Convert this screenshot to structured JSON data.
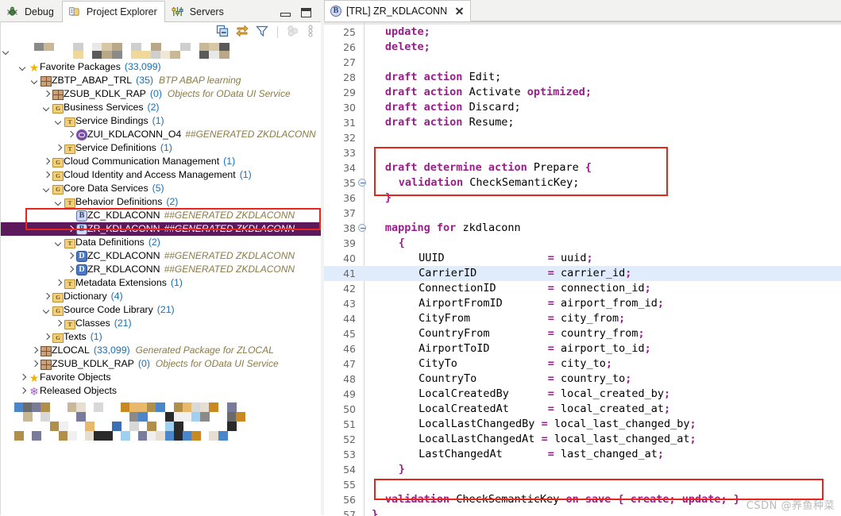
{
  "view_tabs": [
    {
      "label": "Debug",
      "icon": "bug-icon",
      "active": false
    },
    {
      "label": "Project Explorer",
      "icon": "project-explorer-icon",
      "active": true
    },
    {
      "label": "Servers",
      "icon": "servers-icon",
      "active": false
    }
  ],
  "window_controls": {
    "minimize": "minimize-icon",
    "maximize": "maximize-icon"
  },
  "view_toolbar": [
    {
      "name": "collapse-all-icon",
      "label": "Collapse All"
    },
    {
      "name": "link-with-editor-icon",
      "label": "Link with Editor"
    },
    {
      "name": "filter-icon",
      "label": "Filters"
    },
    {
      "name": "group-icon",
      "label": "Grouping"
    },
    {
      "name": "view-menu-icon",
      "label": "View Menu"
    }
  ],
  "tree": {
    "blurred_top_row": true,
    "blurred_bottom_block": true,
    "nodes": [
      {
        "indent": 1,
        "arrow": "down",
        "icon": "star-icon",
        "name": "Favorite Packages",
        "count": "(33,099)",
        "desc": "",
        "selected": false
      },
      {
        "indent": 2,
        "arrow": "down",
        "icon": "package-icon",
        "name": "ZBTP_ABAP_TRL",
        "count": "(35)",
        "desc": "BTP ABAP learning",
        "selected": false
      },
      {
        "indent": 3,
        "arrow": "right",
        "icon": "package-icon",
        "name": "ZSUB_KDLK_RAP",
        "count": "(0)",
        "desc": "Objects for OData UI Service",
        "selected": false
      },
      {
        "indent": 3,
        "arrow": "down",
        "icon": "group-folder-icon",
        "name": "Business Services",
        "count": "(2)",
        "desc": "",
        "selected": false
      },
      {
        "indent": 4,
        "arrow": "down",
        "icon": "type-folder-icon",
        "name": "Service Bindings",
        "count": "(1)",
        "desc": "",
        "selected": false
      },
      {
        "indent": 5,
        "arrow": "right",
        "icon": "service-binding-icon",
        "name": "ZUI_KDLACONN_O4",
        "count": "",
        "desc": "##GENERATED ZKDLACONN",
        "selected": false
      },
      {
        "indent": 4,
        "arrow": "right",
        "icon": "type-folder-icon",
        "name": "Service Definitions",
        "count": "(1)",
        "desc": "",
        "selected": false
      },
      {
        "indent": 3,
        "arrow": "right",
        "icon": "group-folder-icon",
        "name": "Cloud Communication Management",
        "count": "(1)",
        "desc": "",
        "selected": false
      },
      {
        "indent": 3,
        "arrow": "right",
        "icon": "group-folder-icon",
        "name": "Cloud Identity and Access Management",
        "count": "(1)",
        "desc": "",
        "selected": false
      },
      {
        "indent": 3,
        "arrow": "down",
        "icon": "group-folder-icon",
        "name": "Core Data Services",
        "count": "(5)",
        "desc": "",
        "selected": false
      },
      {
        "indent": 4,
        "arrow": "down",
        "icon": "type-folder-icon",
        "name": "Behavior Definitions",
        "count": "(2)",
        "desc": "",
        "selected": false
      },
      {
        "indent": 5,
        "arrow": "none",
        "icon": "behavior-definition-icon",
        "name": "ZC_KDLACONN",
        "count": "",
        "desc": "##GENERATED ZKDLACONN",
        "selected": false
      },
      {
        "indent": 5,
        "arrow": "right",
        "icon": "behavior-definition-icon",
        "name": "ZR_KDLACONN",
        "count": "",
        "desc": "##GENERATED ZKDLACONN",
        "selected": true
      },
      {
        "indent": 4,
        "arrow": "down",
        "icon": "type-folder-icon",
        "name": "Data Definitions",
        "count": "(2)",
        "desc": "",
        "selected": false
      },
      {
        "indent": 5,
        "arrow": "right",
        "icon": "data-definition-icon",
        "name": "ZC_KDLACONN",
        "count": "",
        "desc": "##GENERATED ZKDLACONN",
        "selected": false
      },
      {
        "indent": 5,
        "arrow": "right",
        "icon": "data-definition-icon",
        "name": "ZR_KDLACONN",
        "count": "",
        "desc": "##GENERATED ZKDLACONN",
        "selected": false
      },
      {
        "indent": 4,
        "arrow": "right",
        "icon": "type-folder-icon",
        "name": "Metadata Extensions",
        "count": "(1)",
        "desc": "",
        "selected": false
      },
      {
        "indent": 3,
        "arrow": "right",
        "icon": "group-folder-icon",
        "name": "Dictionary",
        "count": "(4)",
        "desc": "",
        "selected": false
      },
      {
        "indent": 3,
        "arrow": "down",
        "icon": "group-folder-icon",
        "name": "Source Code Library",
        "count": "(21)",
        "desc": "",
        "selected": false
      },
      {
        "indent": 4,
        "arrow": "right",
        "icon": "type-folder-icon",
        "name": "Classes",
        "count": "(21)",
        "desc": "",
        "selected": false
      },
      {
        "indent": 3,
        "arrow": "right",
        "icon": "group-folder-icon",
        "name": "Texts",
        "count": "(1)",
        "desc": "",
        "selected": false
      },
      {
        "indent": 2,
        "arrow": "right",
        "icon": "package-icon",
        "name": "ZLOCAL",
        "count": "(33,099)",
        "desc": "Generated Package for ZLOCAL",
        "selected": false
      },
      {
        "indent": 2,
        "arrow": "right",
        "icon": "package-icon",
        "name": "ZSUB_KDLK_RAP",
        "count": "(0)",
        "desc": "Objects for OData UI Service",
        "selected": false
      },
      {
        "indent": 1,
        "arrow": "right",
        "icon": "star-icon",
        "name": "Favorite Objects",
        "count": "",
        "desc": "",
        "selected": false
      },
      {
        "indent": 1,
        "arrow": "right",
        "icon": "released-objects-icon",
        "name": "Released Objects",
        "count": "",
        "desc": "",
        "selected": false
      }
    ]
  },
  "editor": {
    "tab": {
      "icon": "behavior-definition-icon",
      "label": "[TRL] ZR_KDLACONN",
      "close": "close-icon"
    },
    "lines": [
      {
        "n": 25,
        "fold": false,
        "indent": 2,
        "tokens": [
          {
            "t": "update;",
            "k": true
          }
        ]
      },
      {
        "n": 26,
        "fold": false,
        "indent": 2,
        "tokens": [
          {
            "t": "delete;",
            "k": true
          }
        ]
      },
      {
        "n": 27,
        "fold": false,
        "indent": 0,
        "tokens": []
      },
      {
        "n": 28,
        "fold": false,
        "indent": 2,
        "tokens": [
          {
            "t": "draft action ",
            "k": true
          },
          {
            "t": "Edit;",
            "k": false
          }
        ]
      },
      {
        "n": 29,
        "fold": false,
        "indent": 2,
        "tokens": [
          {
            "t": "draft action ",
            "k": true
          },
          {
            "t": "Activate ",
            "k": false
          },
          {
            "t": "optimized;",
            "k": true
          }
        ]
      },
      {
        "n": 30,
        "fold": false,
        "indent": 2,
        "tokens": [
          {
            "t": "draft action ",
            "k": true
          },
          {
            "t": "Discard;",
            "k": false
          }
        ]
      },
      {
        "n": 31,
        "fold": false,
        "indent": 2,
        "tokens": [
          {
            "t": "draft action ",
            "k": true
          },
          {
            "t": "Resume;",
            "k": false
          }
        ]
      },
      {
        "n": 32,
        "fold": false,
        "indent": 0,
        "tokens": []
      },
      {
        "n": 33,
        "fold": false,
        "indent": 0,
        "tokens": []
      },
      {
        "n": 34,
        "fold": false,
        "indent": 2,
        "tokens": [
          {
            "t": "draft determine action ",
            "k": true
          },
          {
            "t": "Prepare ",
            "k": false
          },
          {
            "t": "{",
            "k": true
          }
        ]
      },
      {
        "n": 35,
        "fold": true,
        "indent": 4,
        "tokens": [
          {
            "t": "validation ",
            "k": true
          },
          {
            "t": "CheckSemanticKey;",
            "k": false
          }
        ]
      },
      {
        "n": 36,
        "fold": false,
        "indent": 2,
        "tokens": [
          {
            "t": "}",
            "k": true
          }
        ]
      },
      {
        "n": 37,
        "fold": false,
        "indent": 0,
        "tokens": []
      },
      {
        "n": 38,
        "fold": true,
        "indent": 2,
        "tokens": [
          {
            "t": "mapping for ",
            "k": true
          },
          {
            "t": "zkdlaconn",
            "k": false
          }
        ]
      },
      {
        "n": 39,
        "fold": false,
        "indent": 4,
        "tokens": [
          {
            "t": "{",
            "k": true
          }
        ]
      },
      {
        "n": 40,
        "fold": false,
        "indent": 7,
        "tokens": [
          {
            "t": "UUID                ",
            "k": false
          },
          {
            "t": "= ",
            "k": true
          },
          {
            "t": "uuid",
            "k": false
          },
          {
            "t": ";",
            "k": true
          }
        ]
      },
      {
        "n": 41,
        "fold": false,
        "indent": 7,
        "highlight": true,
        "tokens": [
          {
            "t": "CarrierID           ",
            "k": false
          },
          {
            "t": "= ",
            "k": true
          },
          {
            "t": "carrier_id",
            "k": false
          },
          {
            "t": ";",
            "k": true
          }
        ]
      },
      {
        "n": 42,
        "fold": false,
        "indent": 7,
        "tokens": [
          {
            "t": "ConnectionID        ",
            "k": false
          },
          {
            "t": "= ",
            "k": true
          },
          {
            "t": "connection_id",
            "k": false
          },
          {
            "t": ";",
            "k": true
          }
        ]
      },
      {
        "n": 43,
        "fold": false,
        "indent": 7,
        "tokens": [
          {
            "t": "AirportFromID       ",
            "k": false
          },
          {
            "t": "= ",
            "k": true
          },
          {
            "t": "airport_from_id",
            "k": false
          },
          {
            "t": ";",
            "k": true
          }
        ]
      },
      {
        "n": 44,
        "fold": false,
        "indent": 7,
        "tokens": [
          {
            "t": "CityFrom            ",
            "k": false
          },
          {
            "t": "= ",
            "k": true
          },
          {
            "t": "city_from",
            "k": false
          },
          {
            "t": ";",
            "k": true
          }
        ]
      },
      {
        "n": 45,
        "fold": false,
        "indent": 7,
        "tokens": [
          {
            "t": "CountryFrom         ",
            "k": false
          },
          {
            "t": "= ",
            "k": true
          },
          {
            "t": "country_from",
            "k": false
          },
          {
            "t": ";",
            "k": true
          }
        ]
      },
      {
        "n": 46,
        "fold": false,
        "indent": 7,
        "tokens": [
          {
            "t": "AirportToID         ",
            "k": false
          },
          {
            "t": "= ",
            "k": true
          },
          {
            "t": "airport_to_id",
            "k": false
          },
          {
            "t": ";",
            "k": true
          }
        ]
      },
      {
        "n": 47,
        "fold": false,
        "indent": 7,
        "tokens": [
          {
            "t": "CityTo              ",
            "k": false
          },
          {
            "t": "= ",
            "k": true
          },
          {
            "t": "city_to",
            "k": false
          },
          {
            "t": ";",
            "k": true
          }
        ]
      },
      {
        "n": 48,
        "fold": false,
        "indent": 7,
        "tokens": [
          {
            "t": "CountryTo           ",
            "k": false
          },
          {
            "t": "= ",
            "k": true
          },
          {
            "t": "country_to",
            "k": false
          },
          {
            "t": ";",
            "k": true
          }
        ]
      },
      {
        "n": 49,
        "fold": false,
        "indent": 7,
        "tokens": [
          {
            "t": "LocalCreatedBy      ",
            "k": false
          },
          {
            "t": "= ",
            "k": true
          },
          {
            "t": "local_created_by",
            "k": false
          },
          {
            "t": ";",
            "k": true
          }
        ]
      },
      {
        "n": 50,
        "fold": false,
        "indent": 7,
        "tokens": [
          {
            "t": "LocalCreatedAt      ",
            "k": false
          },
          {
            "t": "= ",
            "k": true
          },
          {
            "t": "local_created_at",
            "k": false
          },
          {
            "t": ";",
            "k": true
          }
        ]
      },
      {
        "n": 51,
        "fold": false,
        "indent": 7,
        "tokens": [
          {
            "t": "LocalLastChangedBy ",
            "k": false
          },
          {
            "t": "= ",
            "k": true
          },
          {
            "t": "local_last_changed_by",
            "k": false
          },
          {
            "t": ";",
            "k": true
          }
        ]
      },
      {
        "n": 52,
        "fold": false,
        "indent": 7,
        "tokens": [
          {
            "t": "LocalLastChangedAt ",
            "k": false
          },
          {
            "t": "= ",
            "k": true
          },
          {
            "t": "local_last_changed_at",
            "k": false
          },
          {
            "t": ";",
            "k": true
          }
        ]
      },
      {
        "n": 53,
        "fold": false,
        "indent": 7,
        "tokens": [
          {
            "t": "LastChangedAt       ",
            "k": false
          },
          {
            "t": "= ",
            "k": true
          },
          {
            "t": "last_changed_at",
            "k": false
          },
          {
            "t": ";",
            "k": true
          }
        ]
      },
      {
        "n": 54,
        "fold": false,
        "indent": 4,
        "tokens": [
          {
            "t": "}",
            "k": true
          }
        ]
      },
      {
        "n": 55,
        "fold": false,
        "indent": 0,
        "tokens": []
      },
      {
        "n": 56,
        "fold": false,
        "indent": 2,
        "tokens": [
          {
            "t": "validation ",
            "k": true
          },
          {
            "t": "CheckSemanticKey ",
            "k": false
          },
          {
            "t": "on save { create; update; }",
            "k": true
          }
        ]
      },
      {
        "n": 57,
        "fold": false,
        "indent": 0,
        "tokens": [
          {
            "t": "}",
            "k": true
          }
        ]
      }
    ]
  },
  "annotations": {
    "tree_box_label": "red-highlight-box-tree",
    "code_box_prepare_label": "red-highlight-box-prepare-block",
    "code_box_validation_label": "red-highlight-box-validation-line"
  },
  "watermark": "CSDN @养鱼种菜",
  "colors": {
    "selection": "#5c1a5c",
    "annotation": "#e8241b",
    "keyword": "#9b1d8c",
    "count": "#1a6fb5",
    "description": "#8a7b44",
    "current_line": "#dce9f9"
  }
}
